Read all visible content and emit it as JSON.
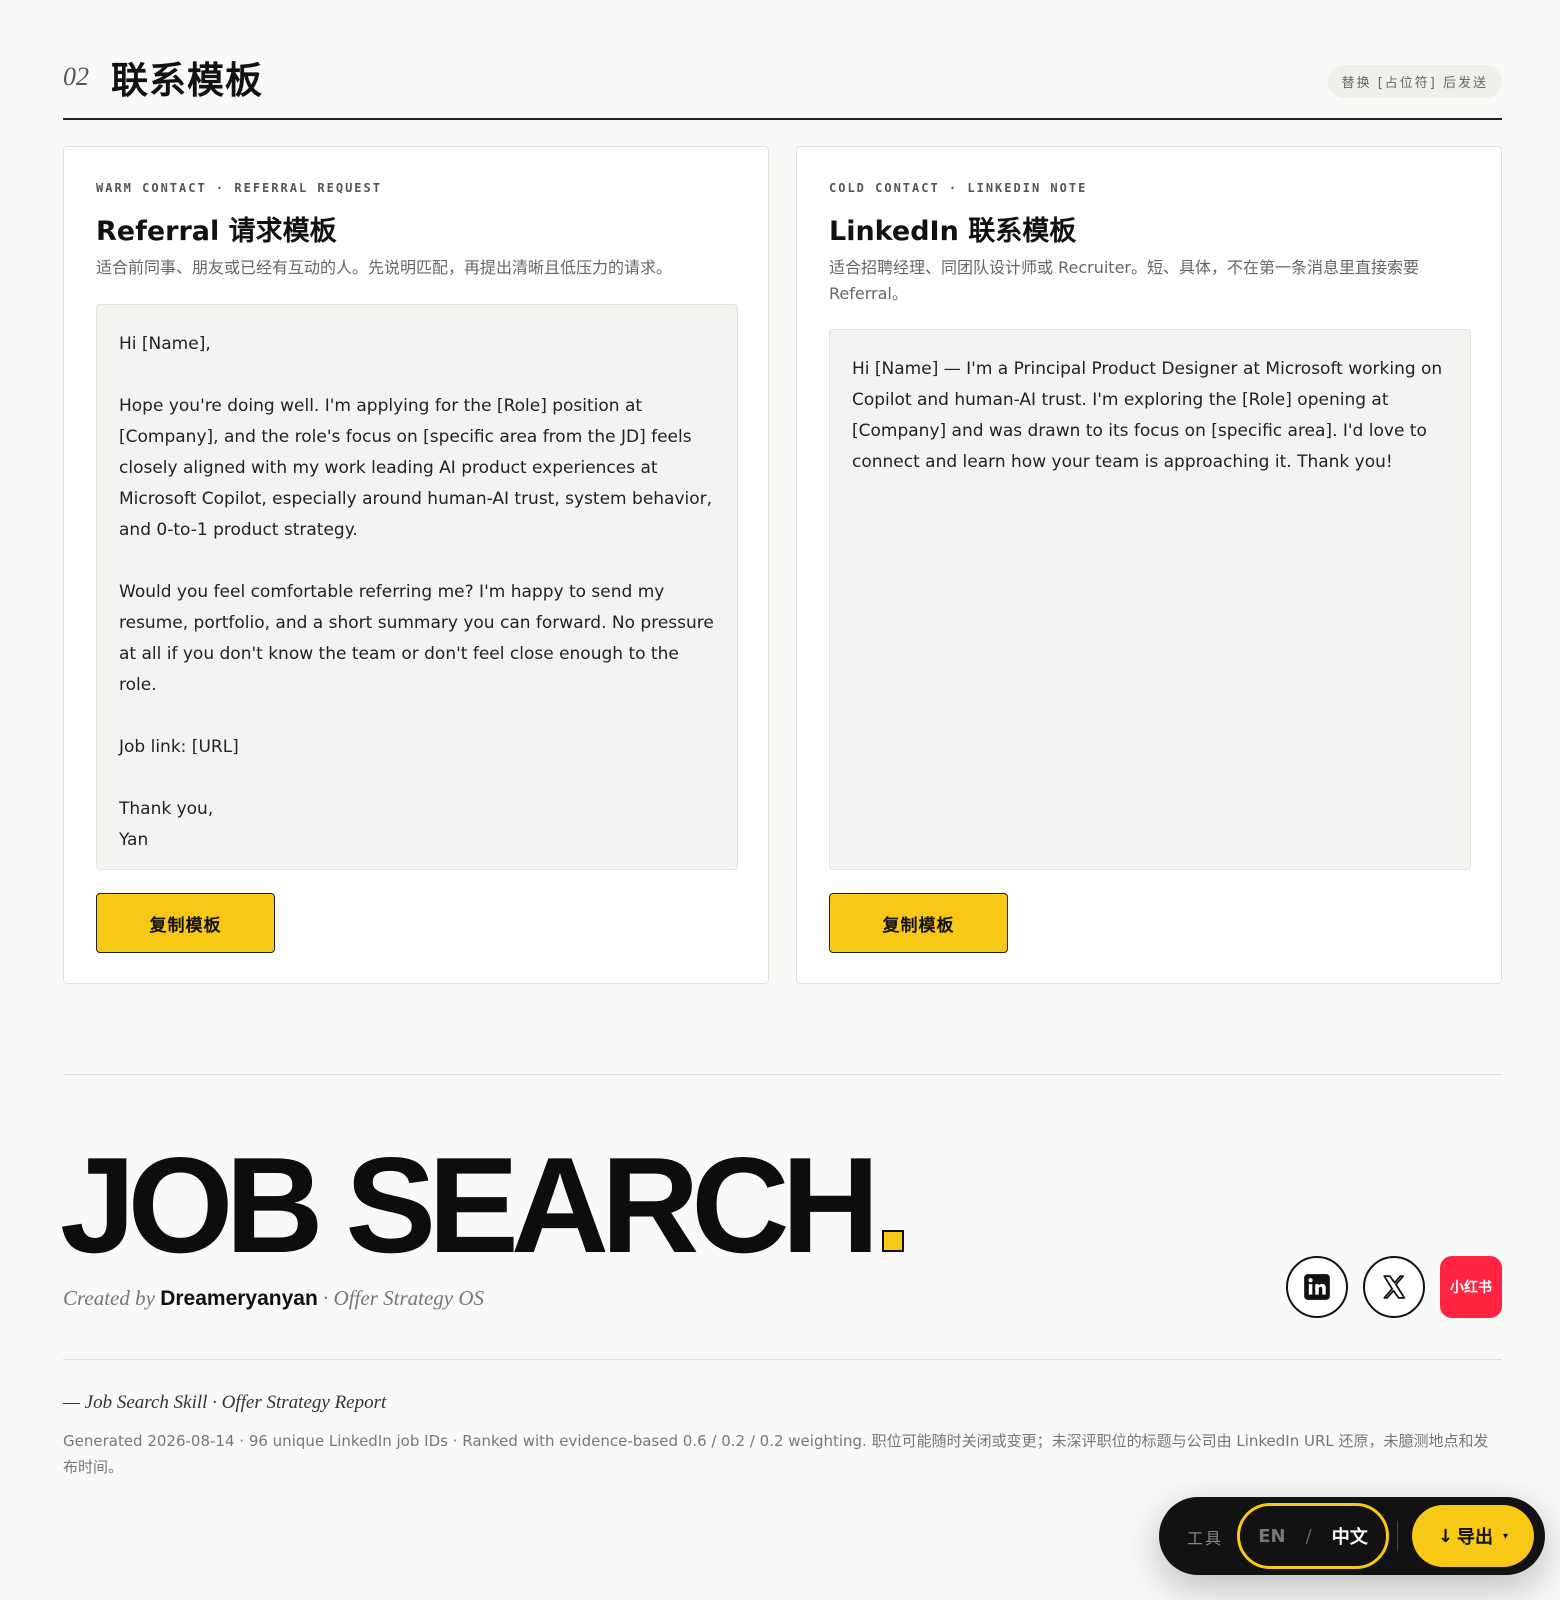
{
  "section": {
    "number": "02",
    "title": "联系模板",
    "hint": "替换 [占位符] 后发送"
  },
  "cards": [
    {
      "eyebrow": "WARM CONTACT · REFERRAL REQUEST",
      "title": "Referral 请求模板",
      "description": "适合前同事、朋友或已经有互动的人。先说明匹配，再提出清晰且低压力的请求。",
      "template": "Hi [Name],\n\nHope you're doing well. I'm applying for the [Role] position at [Company], and the role's focus on [specific area from the JD] feels closely aligned with my work leading AI product experiences at Microsoft Copilot, especially around human-AI trust, system behavior, and 0-to-1 product strategy.\n\nWould you feel comfortable referring me? I'm happy to send my resume, portfolio, and a short summary you can forward. No pressure at all if you don't know the team or don't feel close enough to the role.\n\nJob link: [URL]\n\nThank you,\nYan",
      "copy_label": "复制模板"
    },
    {
      "eyebrow": "COLD CONTACT · LINKEDIN NOTE",
      "title": "LinkedIn 联系模板",
      "description": "适合招聘经理、同团队设计师或 Recruiter。短、具体，不在第一条消息里直接索要 Referral。",
      "template": "Hi [Name] — I'm a Principal Product Designer at Microsoft working on Copilot and human-AI trust. I'm exploring the [Role] opening at [Company] and was drawn to its focus on [specific area]. I'd love to connect and learn how your team is approaching it. Thank you!",
      "copy_label": "复制模板"
    }
  ],
  "brand": {
    "wordmark": "JOB SEARCH",
    "created_by": "Created by",
    "author": "Dreameryanyan",
    "suffix": "· Offer Strategy OS"
  },
  "social": {
    "linkedin_icon": "linkedin-icon",
    "x_icon": "x-icon",
    "xiaohongshu_label": "小红书"
  },
  "footer": {
    "title": "— Job Search Skill · Offer Strategy Report",
    "note": "Generated 2026-08-14 · 96 unique LinkedIn job IDs · Ranked with evidence-based 0.6 / 0.2 / 0.2 weighting. 职位可能随时关闭或变更；未深评职位的标题与公司由 LinkedIn URL 还原，未臆测地点和发布时间。"
  },
  "toolbar": {
    "tools_label": "工具",
    "lang_en": "EN",
    "lang_sep": "/",
    "lang_zh": "中文",
    "export_label": "导出",
    "export_arrow": "↓",
    "export_caret": "▾"
  },
  "colors": {
    "accent": "#f7c815",
    "xiaohongshu": "#ff2442",
    "toolbar_bg": "#121212"
  }
}
